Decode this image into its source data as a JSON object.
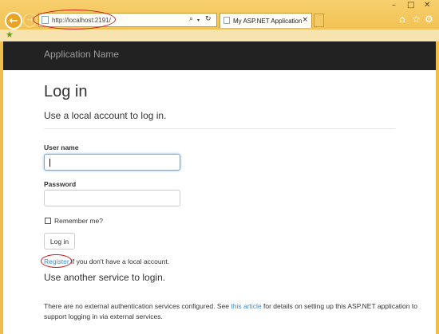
{
  "browser": {
    "url": "http://localhost:2191/",
    "tab_title": "My ASP.NET Application",
    "icons": {
      "back": "back-arrow-icon",
      "forward": "forward-arrow-icon",
      "search": "search-icon",
      "refresh": "refresh-icon",
      "home": "home-icon",
      "favorites": "star-icon",
      "tools": "gear-icon",
      "favorites_bar_add": "add-favorite-icon"
    },
    "accent_color": "#f0bd4a"
  },
  "navbar": {
    "brand": "Application Name"
  },
  "login": {
    "title": "Log in",
    "subtitle": "Use a local account to log in.",
    "username_label": "User name",
    "username_value": "",
    "password_label": "Password",
    "password_value": "",
    "remember_label": "Remember me?",
    "remember_checked": false,
    "submit_label": "Log in",
    "register_link": "Register",
    "register_suffix": " if you don't have a local account."
  },
  "external": {
    "heading": "Use another service to login.",
    "text_before": "There are no external authentication services configured. See ",
    "link": "this article",
    "text_after": " for details on setting up this ASP.NET application to support logging in via external services."
  },
  "annotations_color": "#c91e1e",
  "link_color": "#428bca"
}
